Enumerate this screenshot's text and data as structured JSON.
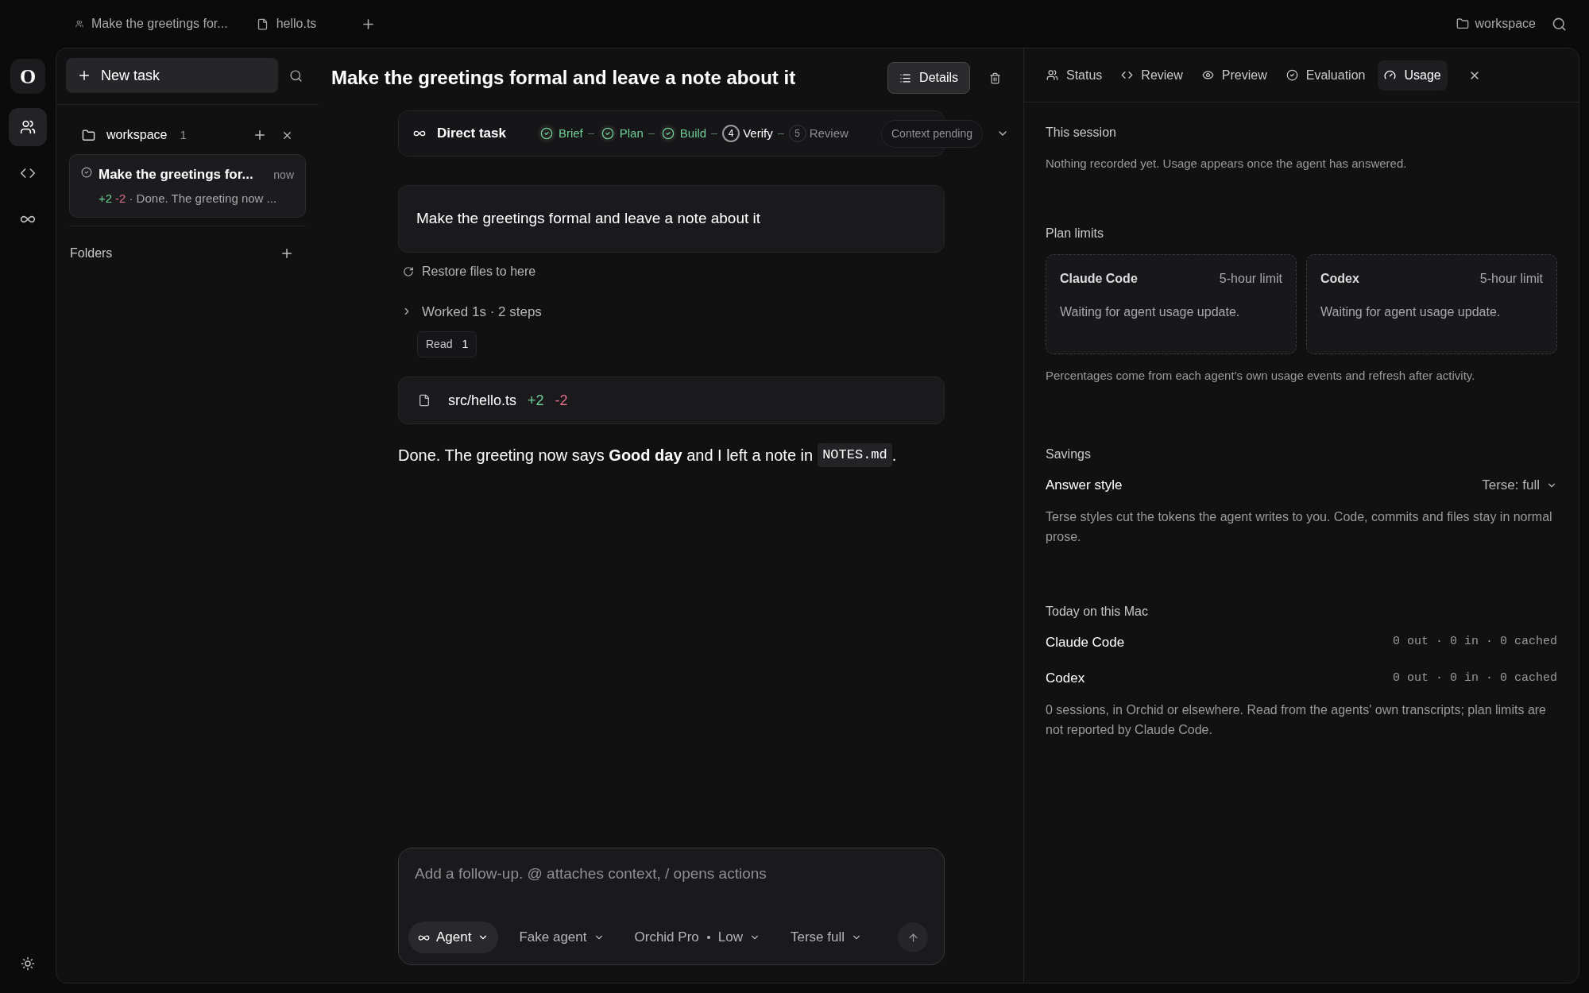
{
  "top_tabs": [
    {
      "kind": "task",
      "title": "Make the greetings for..."
    },
    {
      "kind": "file",
      "title": "hello.ts"
    }
  ],
  "top_right": {
    "workspace": "workspace"
  },
  "rail": {
    "logo": "O",
    "items": [
      {
        "kind": "tasks",
        "selected": true
      },
      {
        "kind": "code",
        "selected": false
      },
      {
        "kind": "loops",
        "selected": false
      }
    ]
  },
  "sidebar": {
    "new_task": "New task",
    "workspace": {
      "name": "workspace",
      "count": "1"
    },
    "tasks": [
      {
        "title": "Make the greetings for...",
        "time": "now",
        "added": "+2",
        "removed": "-2",
        "summary": "· Done. The greeting now ...",
        "selected": true
      }
    ],
    "folders_label": "Folders"
  },
  "main": {
    "title": "Make the greetings formal and leave a note about it",
    "details_button": "Details",
    "stepper": {
      "label": "Direct task",
      "steps": [
        {
          "done": true,
          "current": false,
          "label": "Brief"
        },
        {
          "done": true,
          "current": false,
          "label": "Plan"
        },
        {
          "done": true,
          "current": false,
          "label": "Build"
        },
        {
          "done": false,
          "current": true,
          "number": "4",
          "label": "Verify"
        },
        {
          "done": false,
          "current": false,
          "number": "5",
          "label": "Review"
        }
      ],
      "context": "Context pending"
    },
    "message": "Make the greetings formal and leave a note about it",
    "restore": "Restore files to here",
    "worked": {
      "label": "Worked 1s · 2 steps",
      "expanded": false
    },
    "tool_chips": [
      {
        "label": "Read",
        "count": "1"
      }
    ],
    "file_change": {
      "path": "src/hello.ts",
      "added": "+2",
      "removed": "-2"
    },
    "reply": [
      {
        "kind": "text",
        "text": "Done. The greeting now says **Good day** and I left a note in"
      },
      {
        "kind": "code",
        "text": "NOTES.md"
      },
      {
        "kind": "text",
        "text": "."
      }
    ],
    "composer": {
      "placeholder": "Add a follow-up. @ attaches context, / opens actions",
      "chips": [
        {
          "kind": "mode",
          "label": "Agent",
          "selected": true
        },
        {
          "kind": "plain",
          "label": "Fake agent",
          "selected": false
        },
        {
          "kind": "model",
          "label": "Orchid Pro",
          "detail": "Low",
          "selected": false
        },
        {
          "kind": "plain",
          "label": "Terse full",
          "selected": false
        }
      ]
    }
  },
  "panel": {
    "tabs": [
      {
        "kind": "status",
        "label": "Status",
        "selected": false
      },
      {
        "kind": "review",
        "label": "Review",
        "selected": false
      },
      {
        "kind": "preview",
        "label": "Preview",
        "selected": false
      },
      {
        "kind": "evaluation",
        "label": "Evaluation",
        "selected": false
      },
      {
        "kind": "usage",
        "label": "Usage",
        "selected": true
      }
    ],
    "session": {
      "heading": "This session",
      "text": "Nothing recorded yet. Usage appears once the agent has answered."
    },
    "plan_limits": {
      "heading": "Plan limits",
      "cards": [
        {
          "name": "Claude Code",
          "window": "5-hour limit",
          "status": "Waiting for agent usage update."
        },
        {
          "name": "Codex",
          "window": "5-hour limit",
          "status": "Waiting for agent usage update."
        }
      ],
      "note": "Percentages come from each agent's own usage events and refresh after activity."
    },
    "savings": {
      "heading": "Savings",
      "label": "Answer style",
      "value": "Terse: full",
      "note": "Terse styles cut the tokens the agent writes to you. Code, commits and files stay in normal prose."
    },
    "today": {
      "heading": "Today on this Mac",
      "rows": [
        {
          "name": "Claude Code",
          "stats": "0 out · 0 in · 0 cached"
        },
        {
          "name": "Codex",
          "stats": "0 out · 0 in · 0 cached"
        }
      ],
      "note": "0 sessions, in Orchid or elsewhere. Read from the agents' own transcripts; plan limits are not reported by Claude Code."
    }
  }
}
